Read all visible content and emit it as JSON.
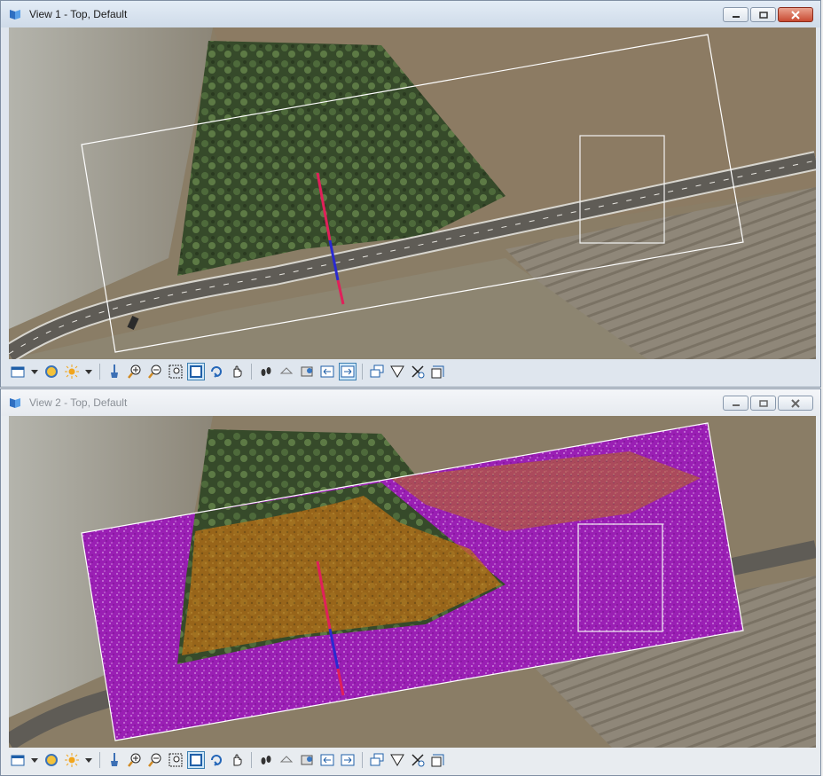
{
  "windows": [
    {
      "title": "View 1 - Top, Default",
      "active": true
    },
    {
      "title": "View 2 - Top, Default",
      "active": false
    }
  ],
  "toolbar_icons": [
    "view-attributes-icon",
    "dropdown-arrow-icon",
    "display-style-icon",
    "lighting-icon",
    "dropdown-arrow-icon",
    "brush-icon",
    "zoom-in-icon",
    "zoom-out-icon",
    "window-area-icon",
    "fit-view-icon",
    "rotate-view-icon",
    "pan-view-icon",
    "walk-icon",
    "previous-view-icon",
    "next-view-icon",
    "copy-view-icon",
    "view-left-icon",
    "view-right-icon",
    "clip-volume-icon",
    "clip-mask-icon",
    "clip-front-icon",
    "clip-back-icon"
  ],
  "colors": {
    "classified_purple": "#9a1fb4",
    "classified_orange": "#b86e14",
    "section_line_red": "#e0205a",
    "section_line_blue": "#2a2ad0",
    "boundary_white": "#ffffff"
  }
}
